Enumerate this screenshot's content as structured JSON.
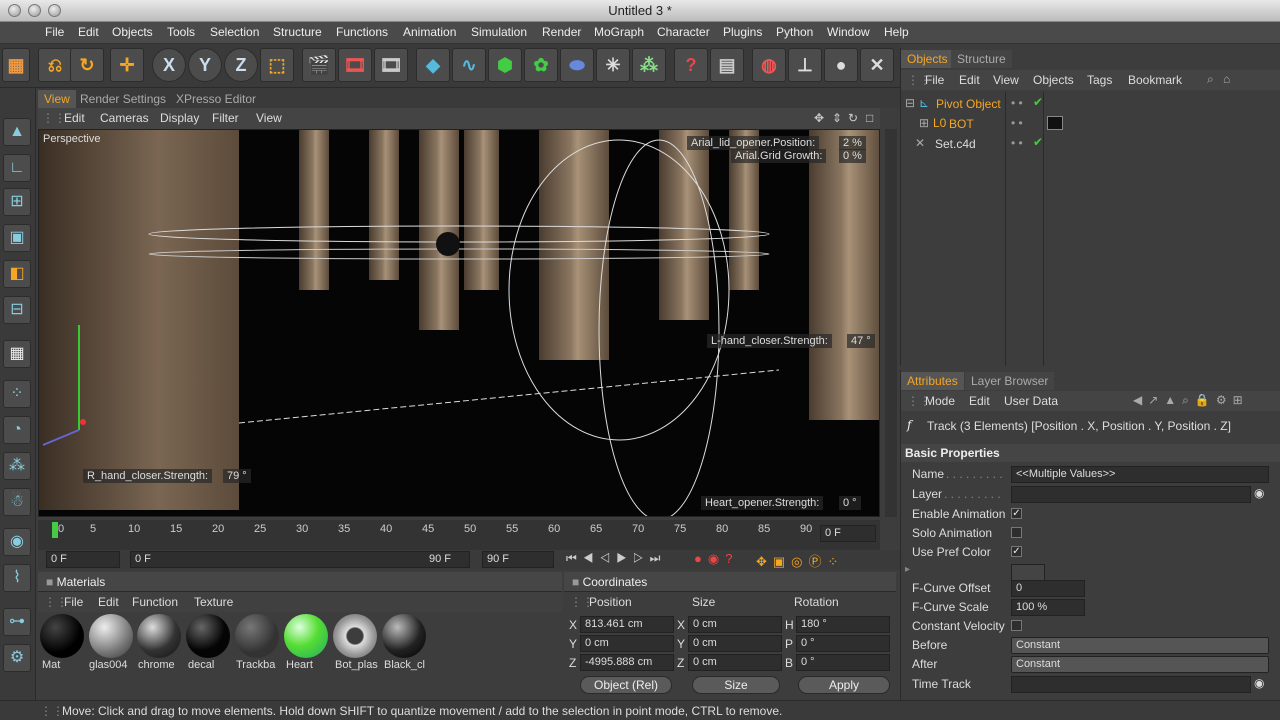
{
  "window": {
    "title": "Untitled 3 *"
  },
  "menu": [
    "File",
    "Edit",
    "Objects",
    "Tools",
    "Selection",
    "Structure",
    "Functions",
    "Animation",
    "Simulation",
    "Render",
    "MoGraph",
    "Character",
    "Plugins",
    "Python",
    "Window",
    "Help"
  ],
  "toolbar": {
    "x": "X",
    "y": "Y",
    "z": "Z"
  },
  "view_tabs": [
    "View",
    "Render Settings",
    "XPresso Editor"
  ],
  "viewport_menu": [
    "Edit",
    "Cameras",
    "Display",
    "Filter",
    "View"
  ],
  "viewport": {
    "label": "Perspective",
    "hud": {
      "arial_lid": "Arial_lid_opener.Position:",
      "arial_lid_val": "2 %",
      "arial_grid": "Arial.Grid Growth:",
      "arial_grid_val": "0 %",
      "lhand": "L-hand_closer.Strength:",
      "lhand_val": "47 °",
      "rhand": "R_hand_closer.Strength:",
      "rhand_val": "79 °",
      "heart": "Heart_opener.Strength:",
      "heart_val": "0 °"
    }
  },
  "timeline": {
    "ticks": [
      "0",
      "5",
      "10",
      "15",
      "20",
      "25",
      "30",
      "35",
      "40",
      "45",
      "50",
      "55",
      "60",
      "65",
      "70",
      "75",
      "80",
      "85",
      "90"
    ],
    "current": "0 F",
    "start": "0 F",
    "range_start": "0 F",
    "range_end": "90 F",
    "end": "90 F"
  },
  "materials": {
    "title": "Materials",
    "menu": [
      "File",
      "Edit",
      "Function",
      "Texture"
    ],
    "items": [
      {
        "name": "Mat"
      },
      {
        "name": "glas004"
      },
      {
        "name": "chrome"
      },
      {
        "name": "decal"
      },
      {
        "name": "Trackba"
      },
      {
        "name": "Heart"
      },
      {
        "name": "Bot_plas"
      },
      {
        "name": "Black_cl"
      }
    ]
  },
  "coordinates": {
    "title": "Coordinates",
    "headers": [
      "Position",
      "Size",
      "Rotation"
    ],
    "rows": [
      {
        "a": "X",
        "pos": "813.461 cm",
        "b": "X",
        "size": "0 cm",
        "c": "H",
        "rot": "180 °"
      },
      {
        "a": "Y",
        "pos": "0 cm",
        "b": "Y",
        "size": "0 cm",
        "c": "P",
        "rot": "0 °"
      },
      {
        "a": "Z",
        "pos": "-4995.888 cm",
        "b": "Z",
        "size": "0 cm",
        "c": "B",
        "rot": "0 °"
      }
    ],
    "mode": "Object (Rel)",
    "size_mode": "Size",
    "apply": "Apply"
  },
  "objects_panel": {
    "tabs": [
      "Objects",
      "Structure"
    ],
    "menu": [
      "File",
      "Edit",
      "View",
      "Objects",
      "Tags",
      "Bookmark"
    ],
    "items": [
      "Pivot Object",
      "BOT",
      "Set.c4d"
    ]
  },
  "attributes": {
    "tabs": [
      "Attributes",
      "Layer Browser"
    ],
    "menu": [
      "Mode",
      "Edit",
      "User Data"
    ],
    "track": "Track (3 Elements) [Position . X, Position . Y, Position . Z]",
    "section": "Basic Properties",
    "fields": {
      "name_label": "Name",
      "name_val": "<<Multiple Values>>",
      "layer_label": "Layer",
      "enable_label": "Enable Animation",
      "solo_label": "Solo Animation",
      "pref_label": "Use Pref Color",
      "offset_label": "F-Curve Offset",
      "offset_val": "0",
      "scale_label": "F-Curve Scale",
      "scale_val": "100 %",
      "const_label": "Constant Velocity",
      "before_label": "Before",
      "before_val": "Constant",
      "after_label": "After",
      "after_val": "Constant",
      "track_label": "Time Track"
    }
  },
  "status": "Move: Click and drag to move elements. Hold down SHIFT to quantize movement / add to the selection in point mode, CTRL to remove."
}
